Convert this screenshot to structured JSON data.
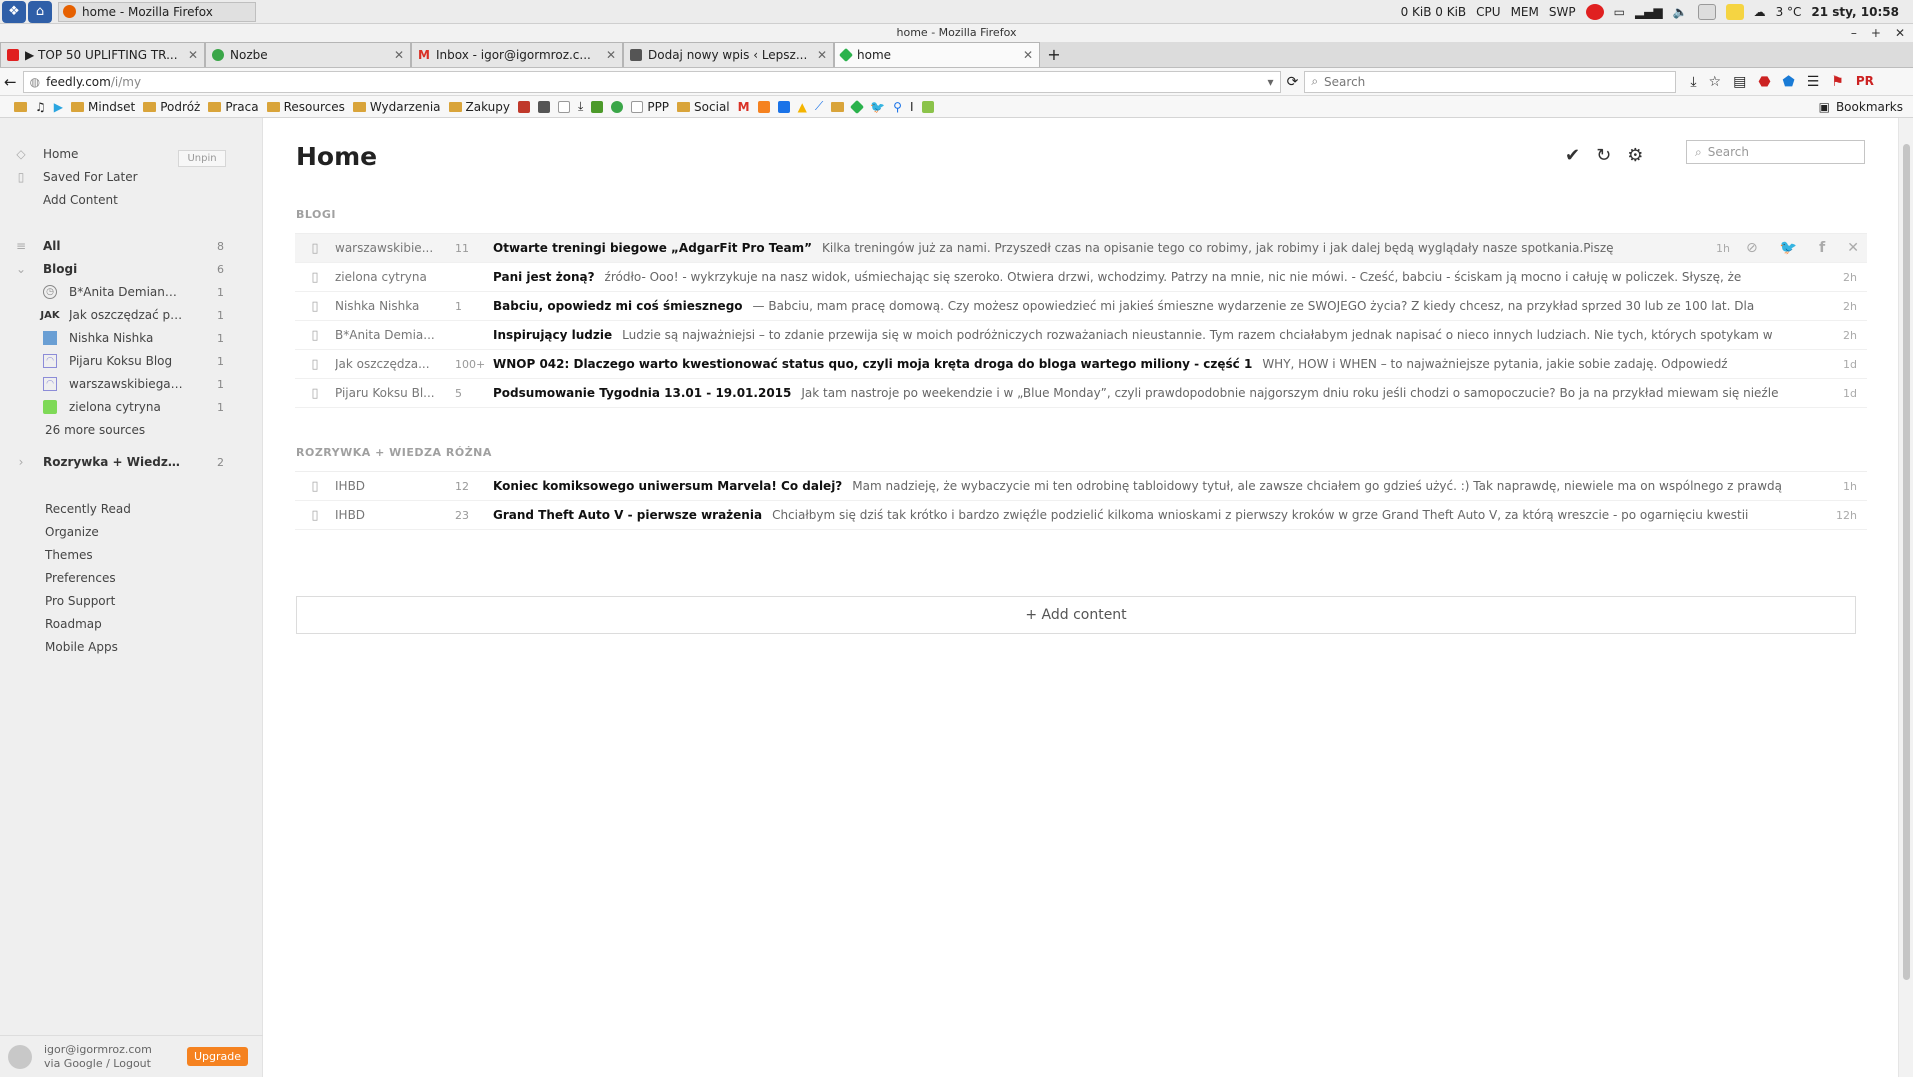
{
  "os": {
    "window_button": "home - Mozilla Firefox",
    "net_io": "0 KiB 0 KiB",
    "cpu_label": "CPU",
    "mem_label": "MEM",
    "swp_label": "SWP",
    "temperature": "3 °C",
    "datetime": "21 sty, 10:58"
  },
  "browser": {
    "title": "home - Mozilla Firefox",
    "tabs": [
      {
        "label": "▶ TOP 50 UPLIFTING TR...",
        "icon": "youtube-icon",
        "color": "#e02020"
      },
      {
        "label": "Nozbe",
        "icon": "check-circle-icon",
        "color": "#3aa648"
      },
      {
        "label": "Inbox - igor@igormroz.c...",
        "icon": "gmail-icon",
        "color": "#d93025"
      },
      {
        "label": "Dodaj nowy wpis ‹ Lepsz...",
        "icon": "wordpress-icon",
        "color": "#555555"
      },
      {
        "label": "home",
        "icon": "feedly-icon",
        "color": "#2bb24c"
      }
    ],
    "url_host": "feedly.com",
    "url_path": "/i/my",
    "search_placeholder": "Search",
    "bookmarks": [
      {
        "label": "",
        "kind": "folder"
      },
      {
        "label": "",
        "kind": "music"
      },
      {
        "label": "",
        "kind": "play"
      },
      {
        "label": "Mindset",
        "kind": "folder"
      },
      {
        "label": "Podróż",
        "kind": "folder"
      },
      {
        "label": "Praca",
        "kind": "folder"
      },
      {
        "label": "Resources",
        "kind": "folder"
      },
      {
        "label": "Wydarzenia",
        "kind": "folder"
      },
      {
        "label": "Zakupy",
        "kind": "folder"
      }
    ],
    "bookmarks2": [
      {
        "label": "PPP",
        "kind": "page"
      },
      {
        "label": "Social",
        "kind": "folder"
      }
    ],
    "bookmarks_menu": "Bookmarks"
  },
  "sidebar": {
    "unpin": "Unpin",
    "nav": [
      {
        "label": "Home",
        "icon": "home-icon"
      },
      {
        "label": "Saved For Later",
        "icon": "bookmark-icon"
      },
      {
        "label": "Add Content",
        "icon": ""
      }
    ],
    "all_label": "All",
    "all_count": "8",
    "group1_label": "Blogi",
    "group1_count": "6",
    "feeds": [
      {
        "label": "B*Anita Demianowicz ...",
        "count": "1",
        "icon": "clock-icon",
        "color": "#888888"
      },
      {
        "label": "Jak oszczędzać pieniąd...",
        "count": "1",
        "icon": "jak-logo-icon",
        "color": "#333333"
      },
      {
        "label": "Nishka Nishka",
        "count": "1",
        "icon": "nishka-icon",
        "color": "#6a9fd4"
      },
      {
        "label": "Pijaru Koksu Blog",
        "count": "1",
        "icon": "rss-icon",
        "color": "#8c8cd8"
      },
      {
        "label": "warszawskibiegacz.pl",
        "count": "1",
        "icon": "rss-icon",
        "color": "#8c8cd8"
      },
      {
        "label": "zielona cytryna",
        "count": "1",
        "icon": "lime-square-icon",
        "color": "#7ed957"
      }
    ],
    "more_sources": "26 more sources",
    "group2_label": "Rozrywka + Wiedza Róż...",
    "group2_count": "2",
    "links": [
      "Recently Read",
      "Organize",
      "Themes",
      "Preferences",
      "Pro Support",
      "Roadmap",
      "Mobile Apps"
    ],
    "user_email": "igor@igormroz.com",
    "user_via": "via Google / Logout",
    "upgrade": "Upgrade"
  },
  "main": {
    "title": "Home",
    "search_placeholder": "Search",
    "section1": "BLOGI",
    "section2": "ROZRYWKA + WIEDZA RÓŻNA",
    "add_content": "+ Add content",
    "blogi_rows": [
      {
        "source": "warszawskibie...",
        "count": "11",
        "title": "Otwarte treningi biegowe „AdgarFit Pro Team”",
        "summary": "Kilka treningów już za nami. Przyszedł czas na opisanie tego co robimy, jak robimy i jak dalej będą wyglądały nasze spotkania.Piszę",
        "age": "1h"
      },
      {
        "source": "zielona cytryna",
        "count": "",
        "title": "Pani jest żoną?",
        "summary": "źródło- Ooo! - wykrzykuje na nasz widok, uśmiechając się szeroko. Otwiera drzwi, wchodzimy. Patrzy na mnie, nic nie mówi. - Cześć, babciu - ściskam ją mocno i całuję w policzek. Słyszę, że",
        "age": "2h"
      },
      {
        "source": "Nishka Nishka",
        "count": "1",
        "title": "Babciu, opowiedz mi coś śmiesznego",
        "summary": "— Babciu, mam pracę domową. Czy możesz opowiedzieć mi jakieś śmieszne wydarzenie ze SWOJEGO życia? Z kiedy chcesz, na przykład sprzed 30 lub ze 100 lat. Dla",
        "age": "2h"
      },
      {
        "source": "B*Anita Demia...",
        "count": "",
        "title": "Inspirujący ludzie",
        "summary": "Ludzie są najważniejsi – to zdanie przewija się w moich podróżniczych rozważaniach nieustannie. Tym razem chciałabym jednak napisać o nieco innych ludziach. Nie tych, których spotykam w",
        "age": "2h"
      },
      {
        "source": "Jak oszczędza...",
        "count": "100+",
        "title": "WNOP 042: Dlaczego warto kwestionować status quo, czyli moja kręta droga do bloga wartego miliony - część 1",
        "summary": "WHY, HOW i WHEN – to najważniejsze pytania, jakie sobie zadaję. Odpowiedź",
        "age": "1d"
      },
      {
        "source": "Pijaru Koksu Bl...",
        "count": "5",
        "title": "Podsumowanie Tygodnia 13.01 - 19.01.2015",
        "summary": "Jak tam nastroje po weekendzie i w „Blue Monday”, czyli prawdopodobnie najgorszym dniu roku jeśli chodzi o samopoczucie? Bo ja na przykład miewam się nieźle",
        "age": "1d"
      }
    ],
    "rozrywka_rows": [
      {
        "source": "IHBD",
        "count": "12",
        "title": "Koniec komiksowego uniwersum Marvela! Co dalej?",
        "summary": "Mam nadzieję, że wybaczycie mi ten odrobinę tabloidowy tytuł, ale zawsze chciałem go gdzieś użyć. :) Tak naprawdę, niewiele ma on wspólnego z prawdą",
        "age": "1h"
      },
      {
        "source": "IHBD",
        "count": "23",
        "title": "Grand Theft Auto V - pierwsze wrażenia",
        "summary": "Chciałbym się dziś tak krótko i bardzo zwięźle podzielić kilkoma wnioskami z pierwszy kroków w grze Grand Theft Auto V, za którą wreszcie - po ogarnięciu kwestii",
        "age": "12h"
      }
    ]
  }
}
